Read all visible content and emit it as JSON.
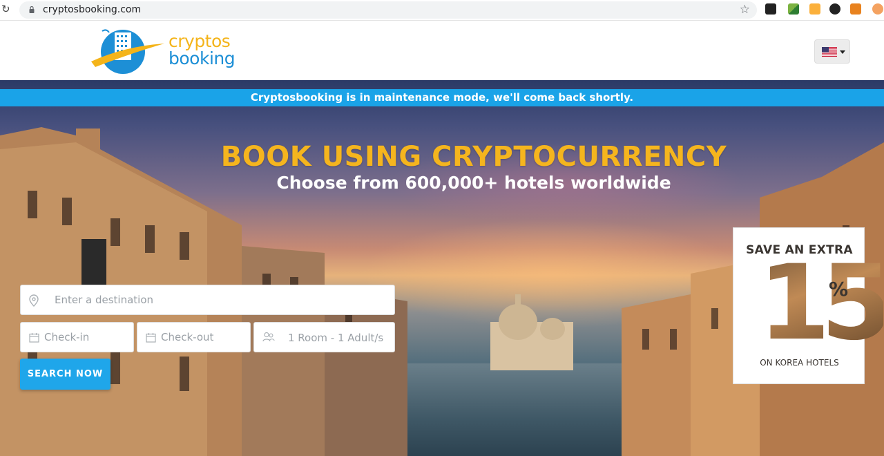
{
  "browser": {
    "url": "cryptosbooking.com"
  },
  "header": {
    "logo_line1": "cryptos",
    "logo_line2": "booking",
    "language": "English (US)"
  },
  "hero": {
    "maintenance_notice": "Cryptosbooking is in maintenance mode, we'll come back shortly.",
    "title": "BOOK USING CRYPTOCURRENCY",
    "subtitle": "Choose from 600,000+ hotels worldwide"
  },
  "search": {
    "destination_placeholder": "Enter a destination",
    "checkin_placeholder": "Check-in",
    "checkout_placeholder": "Check-out",
    "guests_value": "1 Room - 1 Adult/s",
    "submit_label": "SEARCH NOW"
  },
  "promo": {
    "line1": "SAVE AN EXTRA",
    "number": "15",
    "percent": "%",
    "line2": "ON KOREA HOTELS"
  }
}
